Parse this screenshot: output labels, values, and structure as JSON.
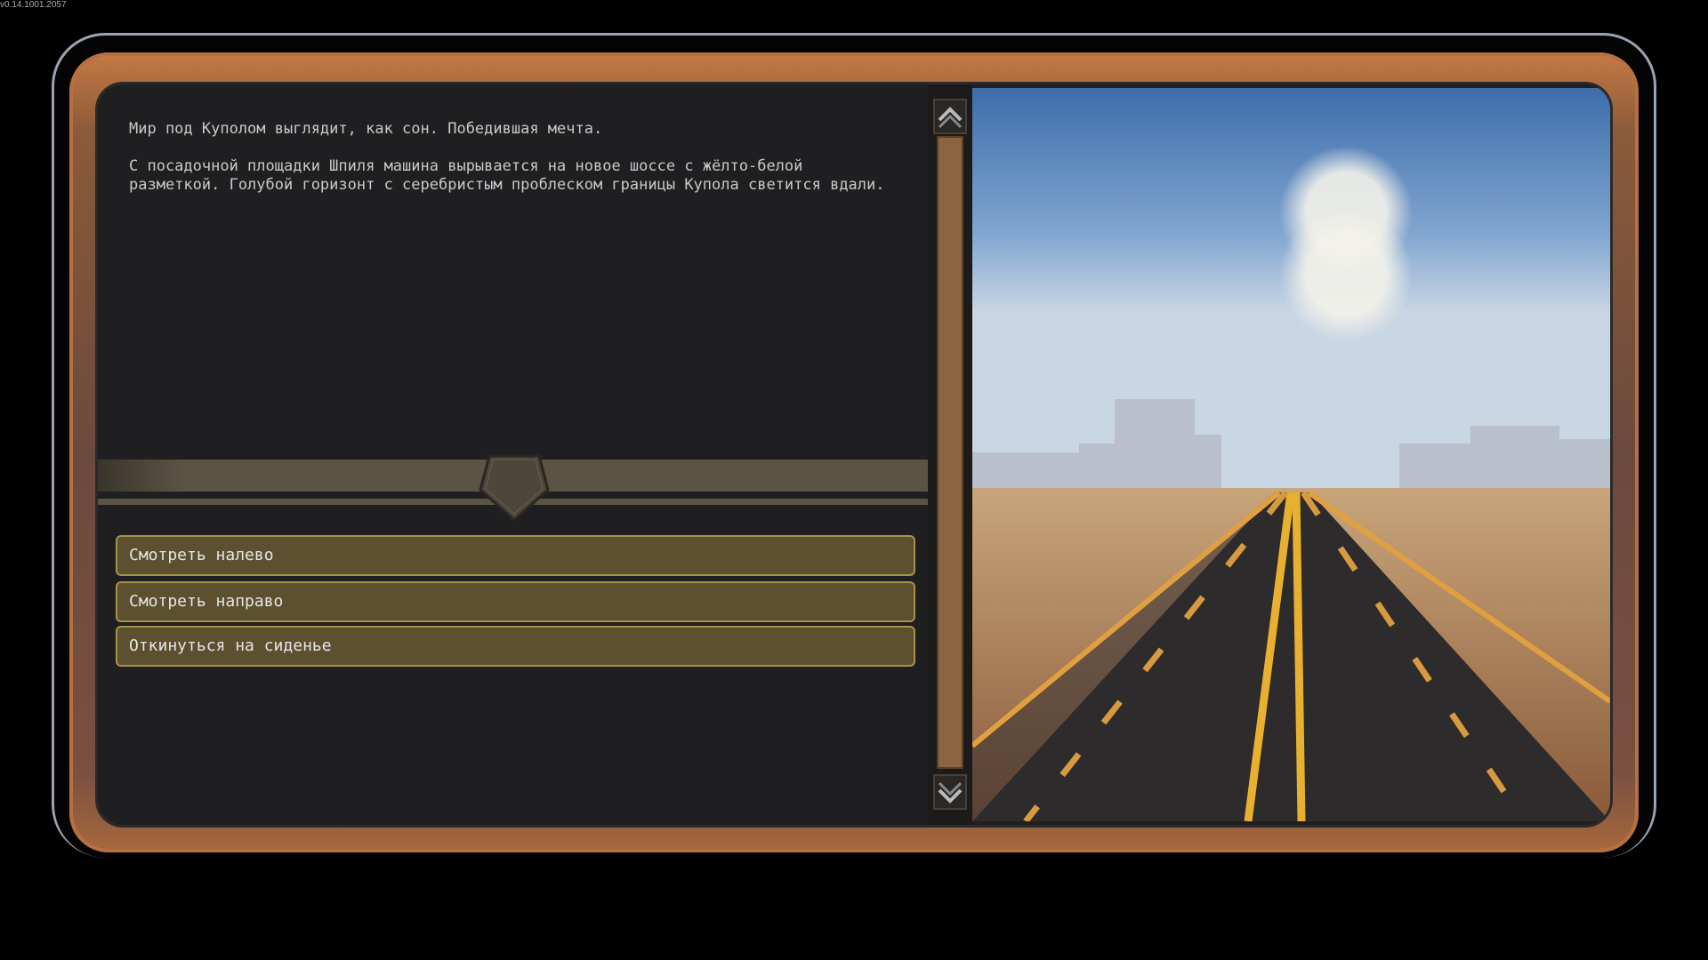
{
  "version": "v0.14.1001.2057",
  "story": {
    "paragraphs": [
      "Мир под Куполом выглядит, как сон. Победившая мечта.",
      "С посадочной площадки Шпиля машина вырывается на новое шоссе с жёлто-белой разметкой. Голубой горизонт с серебристым проблеском границы Купола светится вдали."
    ]
  },
  "choices": [
    {
      "label": "Смотреть налево"
    },
    {
      "label": "Смотреть направо"
    },
    {
      "label": "Откинуться на сиденье"
    }
  ],
  "colors": {
    "choice_bg": "#5c5030",
    "choice_border": "#a49448",
    "frame": "#b87040",
    "scroll_track": "#8b6440"
  }
}
